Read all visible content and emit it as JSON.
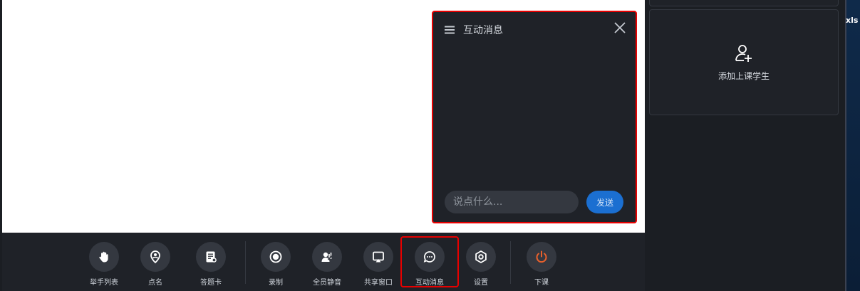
{
  "chat": {
    "title": "互动消息",
    "input_placeholder": "说点什么...",
    "send_label": "发送",
    "menu_icon": "menu-icon",
    "close_icon": "close-icon"
  },
  "toolbar": {
    "items": [
      {
        "label": "举手列表",
        "icon": "raise-hand-icon"
      },
      {
        "label": "点名",
        "icon": "roll-call-icon"
      },
      {
        "label": "答题卡",
        "icon": "answer-card-icon"
      },
      {
        "label": "录制",
        "icon": "record-icon"
      },
      {
        "label": "全员静音",
        "icon": "mute-all-icon"
      },
      {
        "label": "共享窗口",
        "icon": "share-window-icon"
      },
      {
        "label": "互动消息",
        "icon": "chat-icon",
        "active": true
      },
      {
        "label": "设置",
        "icon": "settings-icon"
      },
      {
        "label": "下课",
        "icon": "power-icon",
        "color": "#e8602c"
      }
    ]
  },
  "sidebar": {
    "add_student_label": "添加上课学生",
    "add_student_icon": "add-user-icon"
  },
  "edge": {
    "file_label": "xls"
  },
  "colors": {
    "highlight": "#e60000",
    "send_button": "#1b6fd1",
    "end_class": "#e8602c"
  }
}
